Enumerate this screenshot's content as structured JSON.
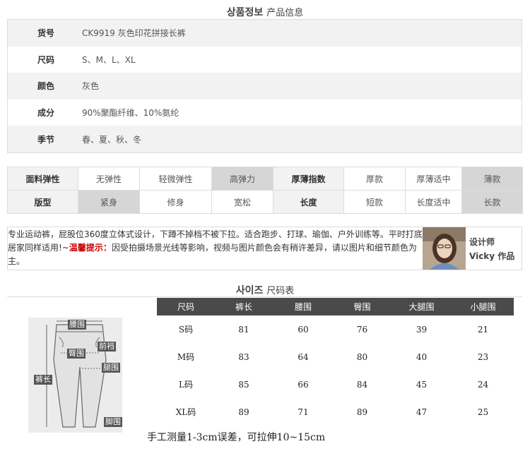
{
  "product_info": {
    "title_ko": "상품정보",
    "title_cn": "产品信息",
    "rows": [
      {
        "label": "货号",
        "value": "CK9919 灰色印花拼接长裤"
      },
      {
        "label": "尺码",
        "value": "S、M、L、XL"
      },
      {
        "label": "颜色",
        "value": "灰色"
      },
      {
        "label": "成分",
        "value": "90%聚酯纤维、10%氨纶"
      },
      {
        "label": "季节",
        "value": "春、夏、秋、冬"
      }
    ]
  },
  "attributes": {
    "row1": {
      "h1": "面料弹性",
      "a": "无弹性",
      "b": "轻微弹性",
      "c": "高弹力",
      "h2": "厚薄指数",
      "d": "厚款",
      "e": "厚薄适中",
      "f": "薄款"
    },
    "row2": {
      "h1": "版型",
      "a": "紧身",
      "b": "修身",
      "c": "宽松",
      "h2": "长度",
      "d": "短款",
      "e": "长度适中",
      "f": "长款"
    },
    "selected": [
      "高弹力",
      "薄款",
      "紧身",
      "长款"
    ]
  },
  "description": {
    "text1": "专业运动裤，屁股位360度立体式设计，下蹲不掉档不被下拉。适合跑步、打球、瑜伽、户外训练等。平时打底居家同样适用!~",
    "tip_label": "温馨提示：",
    "text2": "因受拍摄场景光线等影响，视频与图片颜色会有稍许差异，请以图片和细节颜色为主。",
    "designer_line1": "设计师",
    "designer_line2": "Vicky 作品"
  },
  "size_chart": {
    "title_ko": "사이즈",
    "title_cn": "尺码表",
    "diagram_labels": {
      "waist": "腰围",
      "front_rise": "前裆",
      "hip": "臀围",
      "thigh": "腿围",
      "length": "裤长",
      "hem": "脚围"
    },
    "headers": [
      "尺码",
      "裤长",
      "腰围",
      "臀围",
      "大腿围",
      "小腿围"
    ],
    "rows": [
      [
        "S码",
        "81",
        "60",
        "76",
        "39",
        "21"
      ],
      [
        "M码",
        "83",
        "64",
        "80",
        "40",
        "23"
      ],
      [
        "L码",
        "85",
        "66",
        "84",
        "45",
        "24"
      ],
      [
        "XL码",
        "89",
        "71",
        "89",
        "47",
        "25"
      ]
    ],
    "note": "手工测量1-3cm误差，可拉伸10~15cm"
  }
}
